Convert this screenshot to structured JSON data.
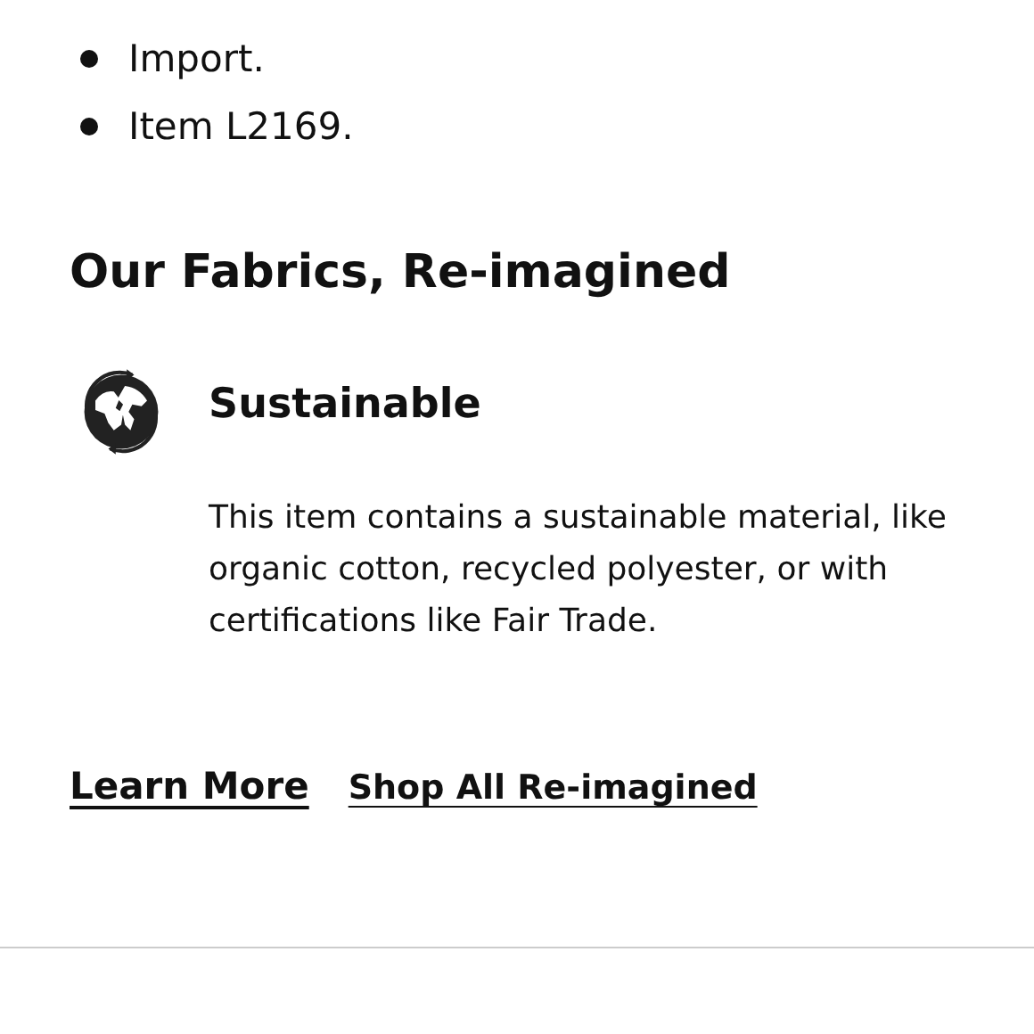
{
  "details": [
    "Import.",
    "Item L2169."
  ],
  "section": {
    "title": "Our Fabrics, Re-imagined",
    "feature": {
      "title": "Sustainable",
      "text": "This item contains a sustainable material, like organic cotton, recycled polyester, or with certifications like Fair Trade."
    },
    "links": [
      "Learn More",
      "Shop All Re-imagined"
    ]
  }
}
